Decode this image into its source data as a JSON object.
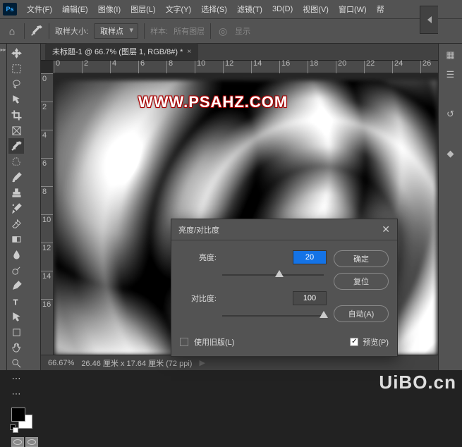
{
  "app": {
    "badge": "Ps"
  },
  "menu": {
    "file": "文件(F)",
    "edit": "编辑(E)",
    "image": "图像(I)",
    "layer": "图层(L)",
    "type": "文字(Y)",
    "select": "选择(S)",
    "filter": "滤镜(T)",
    "threeD": "3D(D)",
    "view": "视图(V)",
    "window": "窗口(W)",
    "help": "帮"
  },
  "options": {
    "sample_size_label": "取样大小:",
    "sample_size_value": "取样点",
    "sample_group_label": "样本:",
    "sample_group_value": "所有图层",
    "show_label": "显示"
  },
  "document": {
    "tab_title": "未标题-1 @ 66.7% (图层 1, RGB/8#) *",
    "tab_close": "×"
  },
  "ruler_h": [
    "0",
    "2",
    "4",
    "6",
    "8",
    "10",
    "12",
    "14",
    "16",
    "18",
    "20",
    "22",
    "24",
    "26"
  ],
  "ruler_v": [
    "0",
    "2",
    "4",
    "6",
    "8",
    "10",
    "12",
    "14",
    "16"
  ],
  "canvas": {
    "watermark": "WWW.PSAHZ.COM"
  },
  "status": {
    "zoom": "66.67%",
    "info": "26.46 厘米 x 17.64 厘米 (72 ppi)",
    "arrow": "▶"
  },
  "dialog": {
    "title": "亮度/对比度",
    "close": "✕",
    "brightness_label": "亮度:",
    "brightness_value": "20",
    "contrast_label": "对比度:",
    "contrast_value": "100",
    "ok": "确定",
    "reset": "复位",
    "auto": "自动(A)",
    "legacy": "使用旧版(L)",
    "preview": "预览(P)",
    "preview_check": "✓"
  },
  "site_watermark": "UiBO.cn"
}
